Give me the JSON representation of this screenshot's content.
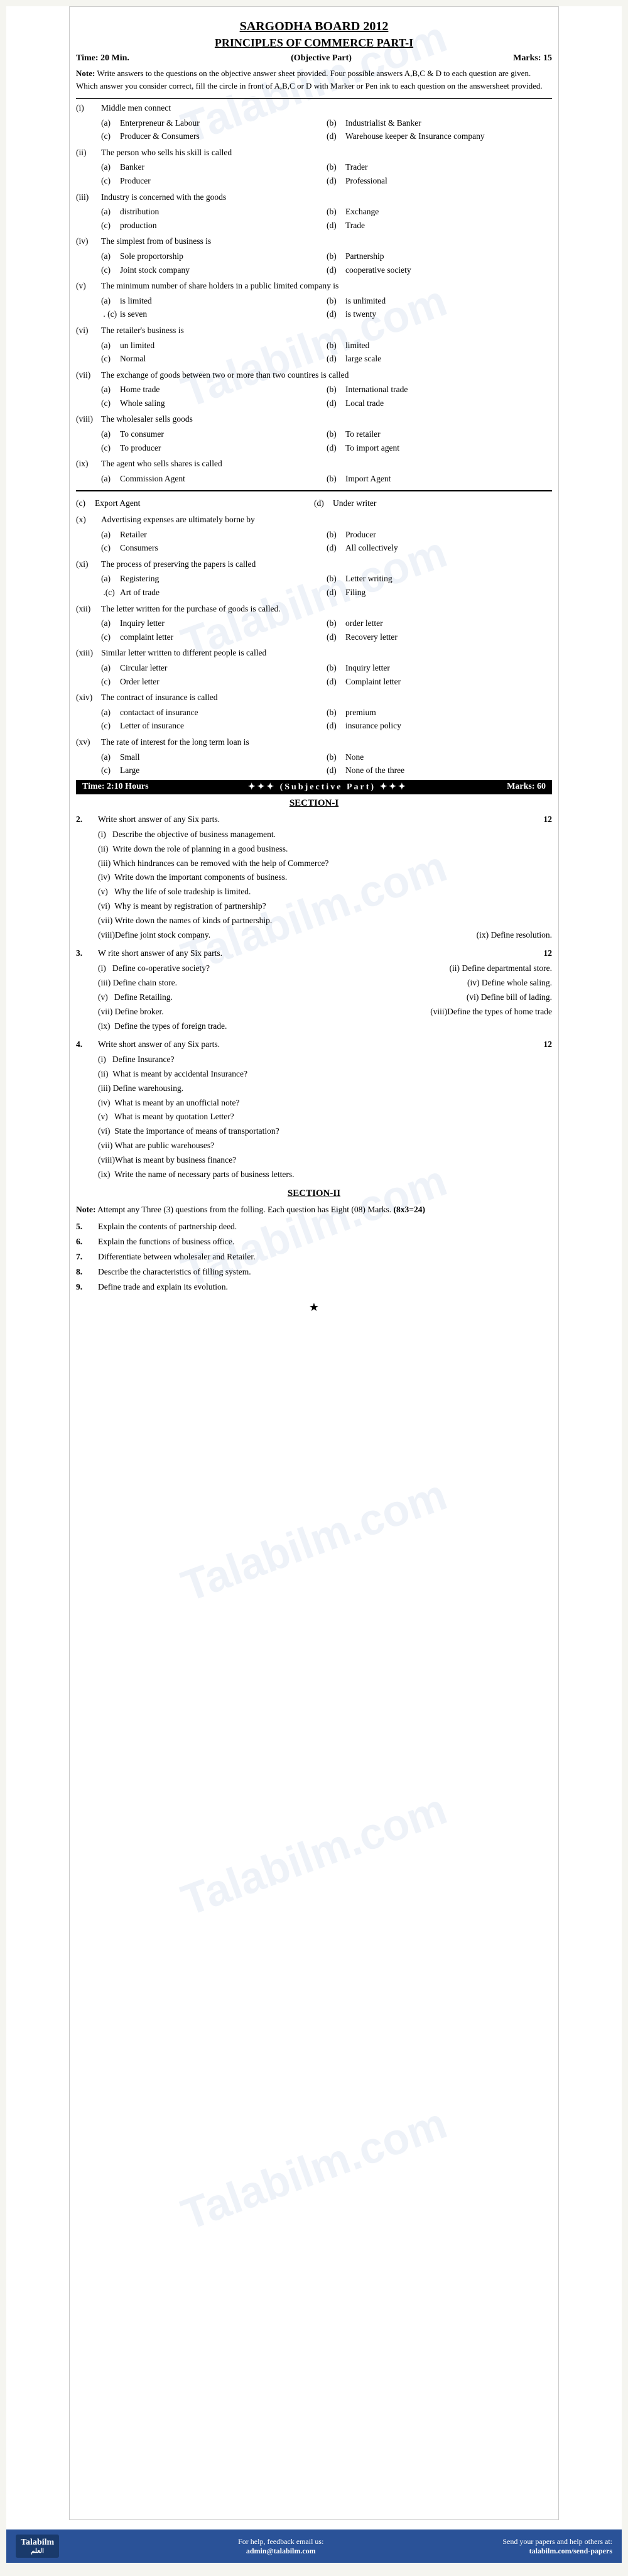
{
  "header": {
    "board": "SARGODHA BOARD 2012",
    "subject": "PRINCIPLES OF COMMERCE PART-I",
    "time_obj": "Time: 20 Min.",
    "part_obj": "(Objective Part)",
    "marks_obj": "Marks: 15",
    "note_label": "Note:",
    "note_text": "Write answers to the questions on the objective answer sheet provided. Four possible answers A,B,C & D to each question are given. Which answer you consider correct, fill the circle in front of A,B,C or D with Marker or Pen ink to each question on the answersheet provided."
  },
  "objective_questions": [
    {
      "num": "(i)",
      "text": "Middle men connect",
      "options": [
        {
          "letter": "(a)",
          "text": "Enterpreneur & Labour"
        },
        {
          "letter": "(b)",
          "text": "Industrialist & Banker"
        },
        {
          "letter": "(c)",
          "text": "Producer & Consumers"
        },
        {
          "letter": "(d)",
          "text": "Warehouse keeper & Insurance company"
        }
      ]
    },
    {
      "num": "(ii)",
      "text": "The person who sells his skill is called",
      "options": [
        {
          "letter": "(a)",
          "text": "Banker"
        },
        {
          "letter": "(b)",
          "text": "Trader"
        },
        {
          "letter": "(c)",
          "text": "Producer"
        },
        {
          "letter": "(d)",
          "text": "Professional"
        }
      ]
    },
    {
      "num": "(iii)",
      "text": "Industry is concerned with the goods",
      "options": [
        {
          "letter": "(a)",
          "text": "distribution"
        },
        {
          "letter": "(b)",
          "text": "Exchange"
        },
        {
          "letter": "(c)",
          "text": "production"
        },
        {
          "letter": "(d)",
          "text": "Trade"
        }
      ]
    },
    {
      "num": "(iv)",
      "text": "The simplest from of business is",
      "options": [
        {
          "letter": "(a)",
          "text": "Sole proportorship"
        },
        {
          "letter": "(b)",
          "text": "Partnership"
        },
        {
          "letter": "(c)",
          "text": "Joint stock company"
        },
        {
          "letter": "(d)",
          "text": "cooperative society"
        }
      ]
    },
    {
      "num": "(v)",
      "text": "The minimum number of share holders in a public limited company is",
      "options": [
        {
          "letter": "(a)",
          "text": "is limited"
        },
        {
          "letter": "(b)",
          "text": "is unlimited"
        },
        {
          "letter": "(c)",
          "text": "is seven"
        },
        {
          "letter": "(d)",
          "text": "is twenty"
        }
      ]
    },
    {
      "num": "(vi)",
      "text": "The retailer's business is",
      "options": [
        {
          "letter": "(a)",
          "text": "un limited"
        },
        {
          "letter": "(b)",
          "text": "limited"
        },
        {
          "letter": "(c)",
          "text": "Normal"
        },
        {
          "letter": "(d)",
          "text": "large scale"
        }
      ]
    },
    {
      "num": "(vii)",
      "text": "The exchange of goods between two or more than two countires is called",
      "options": [
        {
          "letter": "(a)",
          "text": "Home trade"
        },
        {
          "letter": "(b)",
          "text": "International trade"
        },
        {
          "letter": "(c)",
          "text": "Whole saling"
        },
        {
          "letter": "(d)",
          "text": "Local trade"
        }
      ]
    },
    {
      "num": "(viii)",
      "text": "The wholesaler sells goods",
      "options": [
        {
          "letter": "(a)",
          "text": "To consumer"
        },
        {
          "letter": "(b)",
          "text": "To retailer"
        },
        {
          "letter": "(c)",
          "text": "To producer"
        },
        {
          "letter": "(d)",
          "text": "To import agent"
        }
      ]
    },
    {
      "num": "(ix)",
      "text": "The agent who sells shares is called",
      "options": [
        {
          "letter": "(a)",
          "text": "Commission Agent"
        },
        {
          "letter": "(b)",
          "text": "Import Agent"
        }
      ]
    }
  ],
  "objective_questions_cont": [
    {
      "options_only": [
        {
          "letter": "(c)",
          "text": "Export Agent"
        },
        {
          "letter": "(d)",
          "text": "Under writer"
        }
      ]
    },
    {
      "num": "(x)",
      "text": "Advertising expenses are ultimately borne by",
      "options": [
        {
          "letter": "(a)",
          "text": "Retailer"
        },
        {
          "letter": "(b)",
          "text": "Producer"
        },
        {
          "letter": "(c)",
          "text": "Consumers"
        },
        {
          "letter": "(d)",
          "text": "All collectively"
        }
      ]
    },
    {
      "num": "(xi)",
      "text": "The process of preserving the papers is called",
      "options": [
        {
          "letter": "(a)",
          "text": "Registering"
        },
        {
          "letter": "(b)",
          "text": "Letter writing"
        },
        {
          "letter": "(c)",
          "text": "Art of trade"
        },
        {
          "letter": "(d)",
          "text": "Filing"
        }
      ]
    },
    {
      "num": "(xii)",
      "text": "The letter written for the purchase of goods is called.",
      "options": [
        {
          "letter": "(a)",
          "text": "Inquiry letter"
        },
        {
          "letter": "(b)",
          "text": "order letter"
        },
        {
          "letter": "(c)",
          "text": "complaint letter"
        },
        {
          "letter": "(d)",
          "text": "Recovery letter"
        }
      ]
    },
    {
      "num": "(xiii)",
      "text": "Similar letter written to different people is called",
      "options": [
        {
          "letter": "(a)",
          "text": "Circular letter"
        },
        {
          "letter": "(b)",
          "text": "Inquiry letter"
        },
        {
          "letter": "(c)",
          "text": "Order letter"
        },
        {
          "letter": "(d)",
          "text": "Complaint letter"
        }
      ]
    },
    {
      "num": "(xiv)",
      "text": "The contract of insurance is called",
      "options": [
        {
          "letter": "(a)",
          "text": "contactact of insurance"
        },
        {
          "letter": "(b)",
          "text": "premium"
        },
        {
          "letter": "(c)",
          "text": "Letter of insurance"
        },
        {
          "letter": "(d)",
          "text": "insurance policy"
        }
      ]
    },
    {
      "num": "(xv)",
      "text": "The rate of interest for the long term loan is",
      "options": [
        {
          "letter": "(a)",
          "text": "Small"
        },
        {
          "letter": "(b)",
          "text": "None"
        },
        {
          "letter": "(c)",
          "text": "Large"
        },
        {
          "letter": "(d)",
          "text": "None of the three"
        }
      ]
    }
  ],
  "subjective_header": {
    "time": "Time: 2:10 Hours",
    "stars": "✦✦✦",
    "part": "(Subjective Part)",
    "marks": "Marks: 60"
  },
  "section_i": {
    "title": "SECTION-I",
    "q2": {
      "num": "2.",
      "text": "Write short answer of any Six parts.",
      "marks": "12",
      "parts": [
        {
          "num": "(i)",
          "text": "Describe the objective of business management."
        },
        {
          "num": "(ii)",
          "text": "Write down the role of planning in a good business."
        },
        {
          "num": "(iii)",
          "text": "Which hindrances can be removed with the help of Commerce?"
        },
        {
          "num": "(iv)",
          "text": "Write down the important components of business."
        },
        {
          "num": "(v)",
          "text": "Why the life of sole tradeship is limited."
        },
        {
          "num": "(vi)",
          "text": "Why is meant by registration of partnership?"
        },
        {
          "num": "(vii)",
          "text": "Write down the names of kinds of partnership."
        },
        {
          "num": "(viii)",
          "text": "Define joint stock company."
        },
        {
          "num": "(ix)",
          "text": "Define resolution."
        }
      ]
    },
    "q3": {
      "num": "3.",
      "text": "Write short answer of any Six parts.",
      "marks": "12",
      "parts": [
        {
          "num": "(i)",
          "text": "Define co-operative society?"
        },
        {
          "num": "(ii_right)",
          "text": "Define departmental store."
        },
        {
          "num": "(iii)",
          "text": "Define chain store."
        },
        {
          "num": "(iv_right)",
          "text": "Define whole saling."
        },
        {
          "num": "(v)",
          "text": "Define Retailing."
        },
        {
          "num": "(vi_right)",
          "text": "Define bill of lading."
        },
        {
          "num": "(vii)",
          "text": "Define broker."
        },
        {
          "num": "(viii_right)",
          "text": "Define the types of home trade"
        },
        {
          "num": "(ix)",
          "text": "Define the types of foreign trade."
        }
      ]
    },
    "q4": {
      "num": "4.",
      "text": "Write short answer of any Six parts.",
      "marks": "12",
      "parts": [
        {
          "num": "(i)",
          "text": "Define Insurance?"
        },
        {
          "num": "(ii)",
          "text": "What is meant by accidental Insurance?"
        },
        {
          "num": "(iii)",
          "text": "Define warehousing."
        },
        {
          "num": "(iv)",
          "text": "What is meant by an unofficial note?"
        },
        {
          "num": "(v)",
          "text": "What is meant by quotation Letter?"
        },
        {
          "num": "(vi)",
          "text": "State the importance of means of transportation?"
        },
        {
          "num": "(vii)",
          "text": "What are public warehouses?"
        },
        {
          "num": "(viii)",
          "text": "What is meant by business finance?"
        },
        {
          "num": "(ix)",
          "text": "Write the name of necessary parts of business letters."
        }
      ]
    }
  },
  "section_ii": {
    "title": "SECTION-II",
    "note": "Note:",
    "note_text": "Attempt any Three (3) questions from the folling. Each question has Eight (08) Marks.",
    "marks_info": "(8x3=24)",
    "questions": [
      {
        "num": "5.",
        "text": "Explain the contents of partnership deed."
      },
      {
        "num": "6.",
        "text": "Explain the functions of business office."
      },
      {
        "num": "7.",
        "text": "Differentiate between wholesaler and Retailer."
      },
      {
        "num": "8.",
        "text": "Describe the characteristics of filling system."
      },
      {
        "num": "9.",
        "text": "Define trade and explain its evolution."
      }
    ]
  },
  "footer": {
    "logo_text": "Talabilm",
    "logo_sub": "العلم",
    "help_label": "For help, feedback email us:",
    "email": "admin@talabilm.com",
    "send_label": "Send your papers and help others at:",
    "url": "talabilm.com/send-papers"
  },
  "watermark": {
    "line1": "Talabilm",
    "line2": ".com"
  }
}
